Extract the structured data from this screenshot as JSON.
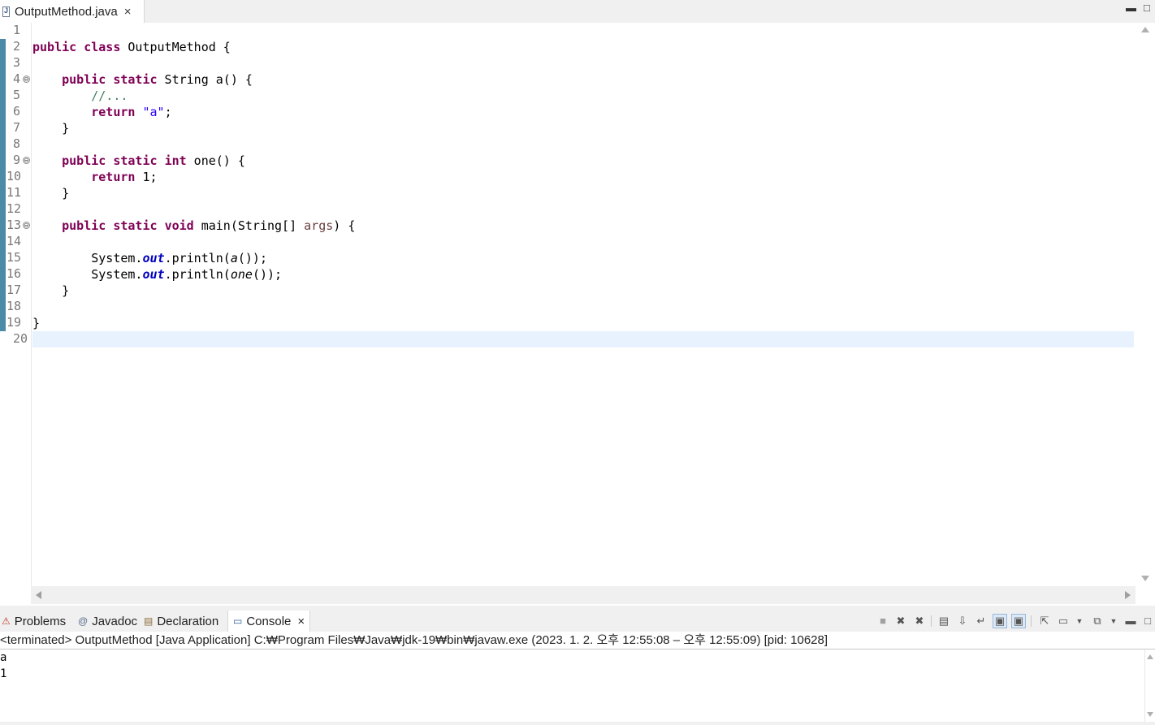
{
  "editor_tab": {
    "title": "OutputMethod.java",
    "close": "×"
  },
  "window_controls": {
    "minimize": "▬",
    "maximize": "□"
  },
  "editor": {
    "line_numbers": [
      "1",
      "2",
      "3",
      "4",
      "5",
      "6",
      "7",
      "8",
      "9",
      "10",
      "11",
      "12",
      "13",
      "14",
      "15",
      "16",
      "17",
      "18",
      "19",
      "20"
    ],
    "fold_markers": [
      "⊖",
      "⊖",
      "⊖"
    ],
    "code": {
      "l2": {
        "kw1": "public",
        "kw2": "class",
        "rest": " OutputMethod {"
      },
      "l4": {
        "kw1": "public",
        "kw2": "static",
        "rest": " String a() {"
      },
      "l5": {
        "comment": "//..."
      },
      "l6": {
        "kw": "return",
        "str": "\"a\"",
        "end": ";"
      },
      "l7": {
        "text": "}"
      },
      "l9": {
        "kw1": "public",
        "kw2": "static",
        "kw3": "int",
        "rest": " one() {"
      },
      "l10": {
        "kw": "return",
        "rest": " 1;"
      },
      "l11": {
        "text": "}"
      },
      "l13": {
        "kw1": "public",
        "kw2": "static",
        "kw3": "void",
        "pre": " main(String[] ",
        "arg": "args",
        "post": ") {"
      },
      "l15": {
        "a": "System.",
        "field": "out",
        "b": ".println(",
        "call": "a",
        "c": "());"
      },
      "l16": {
        "a": "System.",
        "field": "out",
        "b": ".println(",
        "call": "one",
        "c": "());"
      },
      "l17": {
        "text": "}"
      },
      "l19": {
        "text": "}"
      }
    }
  },
  "bottom_panel": {
    "tabs": [
      {
        "label": "Problems",
        "icon": "problems-icon"
      },
      {
        "label": "Javadoc",
        "icon": "javadoc-icon"
      },
      {
        "label": "Declaration",
        "icon": "declaration-icon"
      },
      {
        "label": "Console",
        "icon": "console-icon",
        "active": true
      }
    ],
    "console_close": "×",
    "status": "<terminated> OutputMethod [Java Application] C:₩Program Files₩Java₩jdk-19₩bin₩javaw.exe  (2023. 1. 2. 오후 12:55:08 – 오후 12:55:09) [pid: 10628]",
    "output": [
      "a",
      "1"
    ]
  },
  "colors": {
    "keyword": "#7f0055",
    "comment": "#3f7f5f",
    "string": "#2a00ff",
    "field": "#0000c0",
    "current_line": "#e8f2fe"
  }
}
